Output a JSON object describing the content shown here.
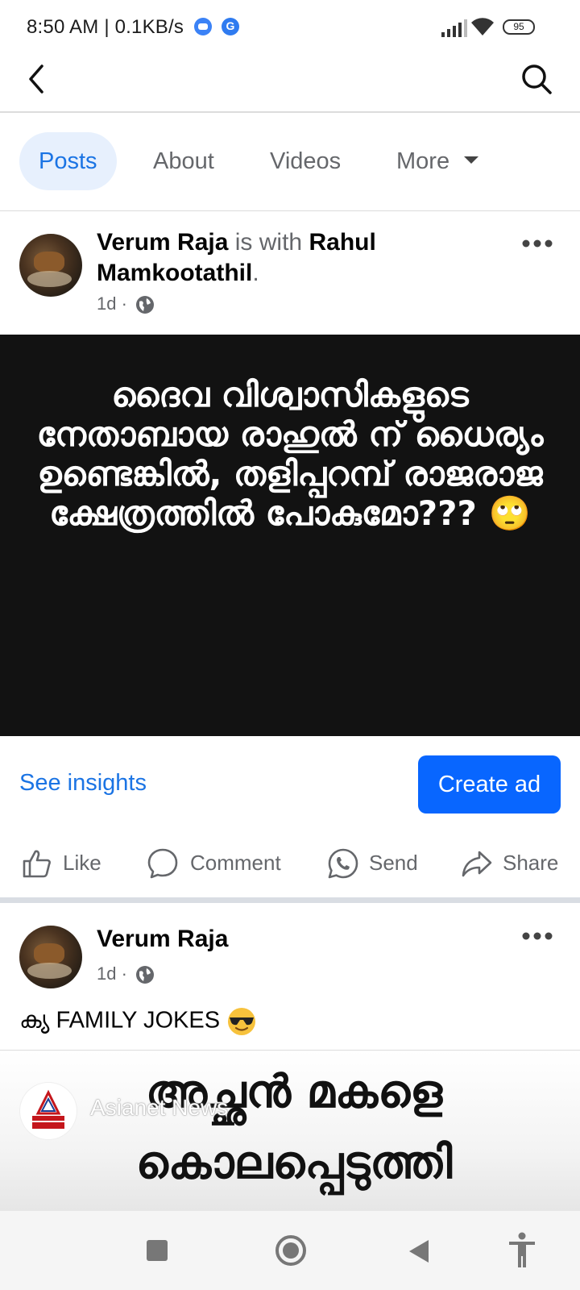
{
  "status_bar": {
    "time_and_speed": "8:50 AM | 0.1KB/s",
    "battery": "95"
  },
  "tabs": [
    {
      "label": "Posts",
      "active": true
    },
    {
      "label": "About",
      "active": false
    },
    {
      "label": "Videos",
      "active": false
    },
    {
      "label": "More",
      "active": false
    }
  ],
  "post1": {
    "author": "Verum Raja",
    "with_text": "is with",
    "tagged": "Rahul Mamkootathil",
    "period": ".",
    "time": "1d",
    "separator": "·",
    "image_text": "ദൈവ വിശ്വാസികളുടെ നേതാബായ രാഹുൽ ന് ധൈര്യം ഉണ്ടെങ്കിൽ, തളിപ്പറമ്പ് രാജരാജ ക്ഷേത്രത്തിൽ പോകുമോ??? 🙄",
    "see_insights": "See insights",
    "create_ad": "Create ad",
    "actions": {
      "like": "Like",
      "comment": "Comment",
      "send": "Send",
      "share": "Share"
    }
  },
  "post2": {
    "author": "Verum Raja",
    "time": "1d",
    "separator": "·",
    "caption": "ക്യ FAMILY JOKES",
    "channel_name": "Asianet News",
    "image_text": "അച്ഛൻ മകളെ കൊലപ്പെടുത്തി"
  },
  "colors": {
    "accent": "#1b74e4",
    "button": "#0866ff",
    "active_tab_bg": "#e7f0fd",
    "secondary_text": "#65676b"
  }
}
